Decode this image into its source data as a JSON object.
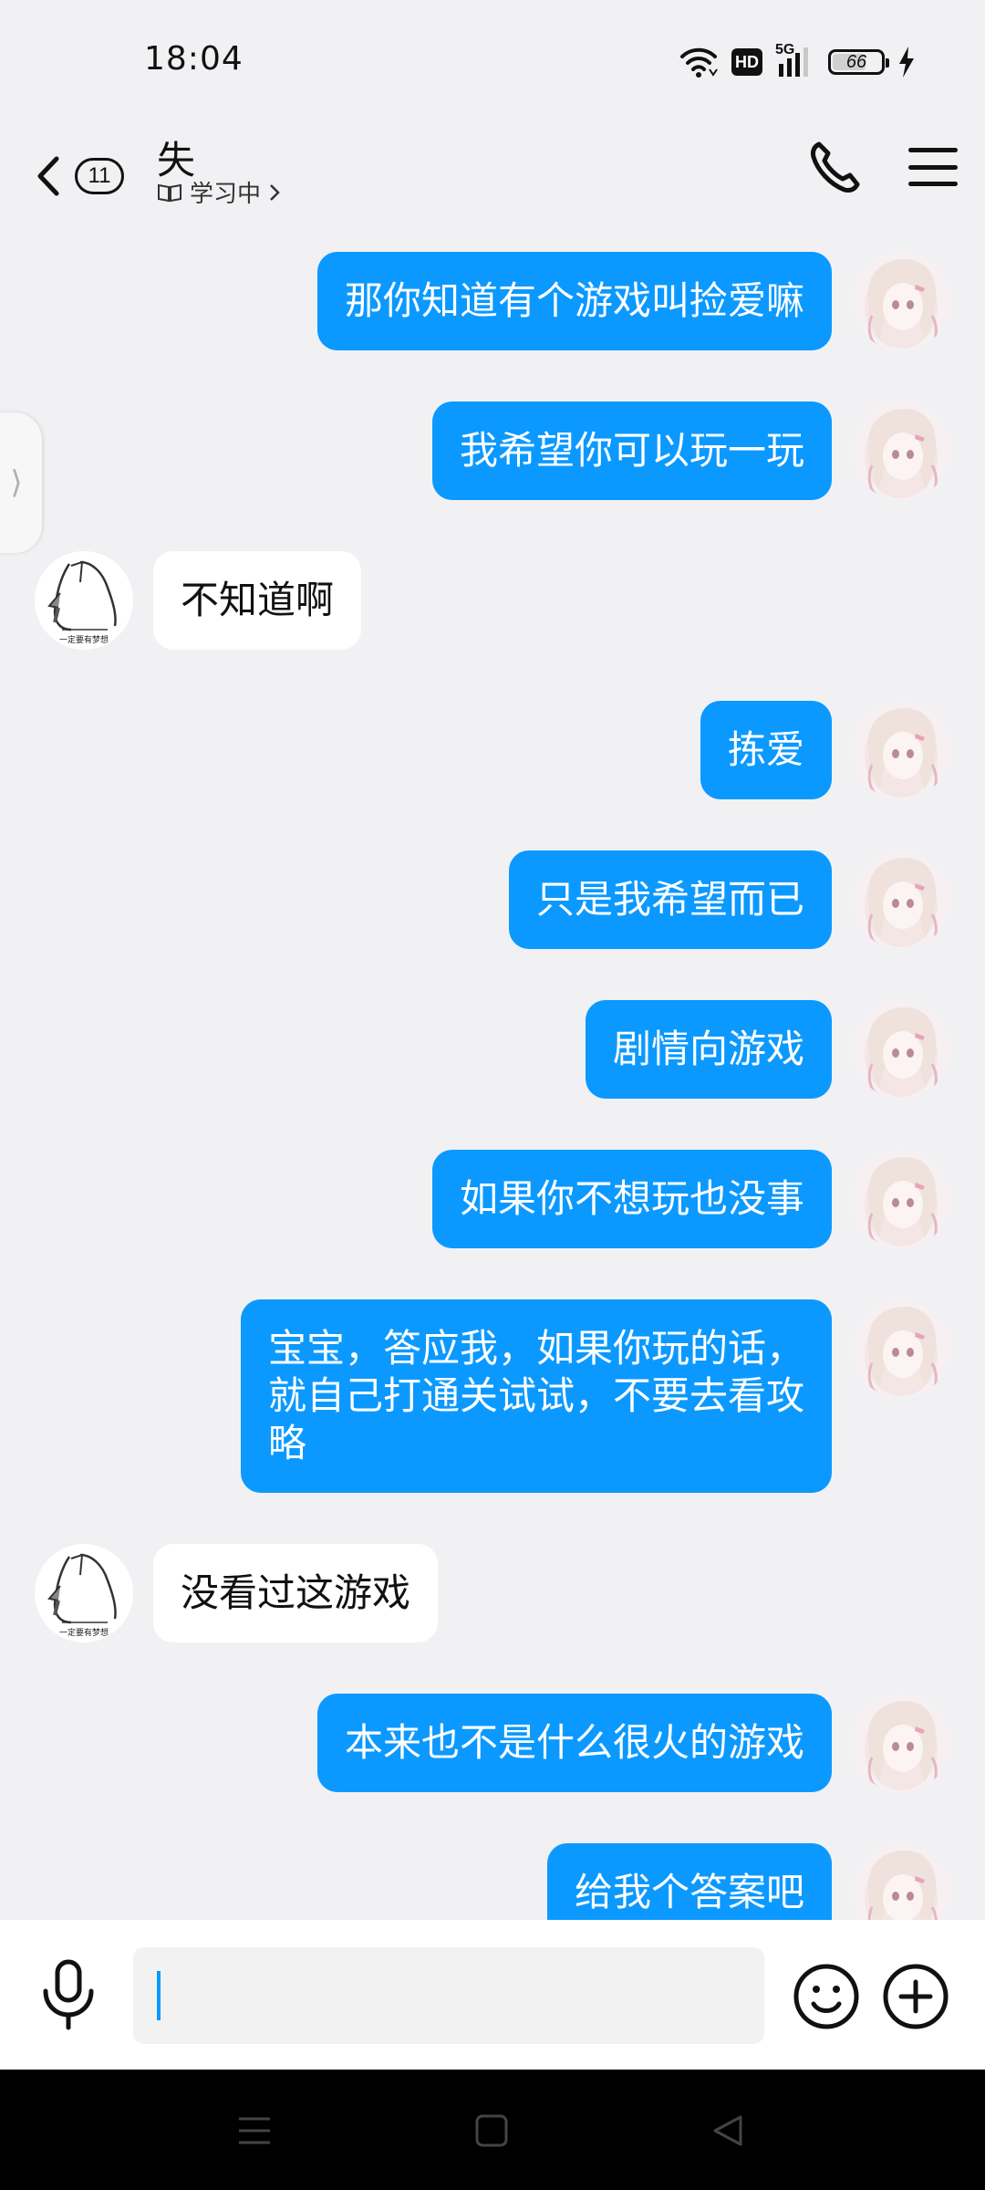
{
  "status_bar": {
    "time": "18:04",
    "hd": "HD",
    "network": "5G",
    "battery": "66",
    "battery_level": 0.66
  },
  "header": {
    "unread_count": "11",
    "contact_name": "失",
    "contact_status": "学习中",
    "icons": {
      "back": "back-arrow-icon",
      "status": "book-icon",
      "phone": "phone-icon",
      "menu": "menu-icon"
    }
  },
  "messages": [
    {
      "sender": "self",
      "text": "那你知道有个游戏叫捡爱嘛"
    },
    {
      "sender": "self",
      "text": "我希望你可以玩一玩"
    },
    {
      "sender": "other",
      "text": "不知道啊"
    },
    {
      "sender": "self",
      "text": "拣爱"
    },
    {
      "sender": "self",
      "text": "只是我希望而已"
    },
    {
      "sender": "self",
      "text": "剧情向游戏"
    },
    {
      "sender": "self",
      "text": "如果你不想玩也没事"
    },
    {
      "sender": "self",
      "text": "宝宝，答应我，如果你玩的话，\n就自己打通关试试，不要去看攻\n略"
    },
    {
      "sender": "other",
      "text": "没看过这游戏"
    },
    {
      "sender": "self",
      "text": "本来也不是什么很火的游戏"
    },
    {
      "sender": "self",
      "text": "给我个答案吧"
    }
  ],
  "input_bar": {
    "value": "",
    "icons": {
      "mic": "microphone-icon",
      "emoji": "emoji-icon",
      "plus": "plus-icon"
    }
  },
  "colors": {
    "self_bubble": "#0b99ff",
    "other_bubble": "#ffffff",
    "background": "#f1f1f3"
  }
}
